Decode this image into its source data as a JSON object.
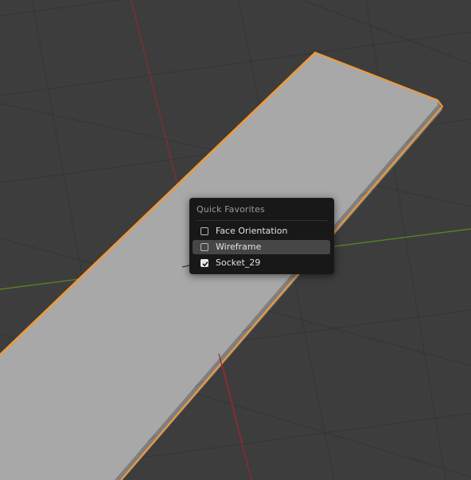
{
  "app": {
    "name": "Blender 3D Viewport"
  },
  "viewport": {
    "background_color": "#3d3d3d",
    "grid_color": "#333333",
    "x_axis_color": "#8a2a33",
    "y_axis_color": "#5c8a1e",
    "selection_outline_color": "#f29a36",
    "object_color": "#a8a8a8"
  },
  "quick_favorites": {
    "title": "Quick Favorites",
    "items": [
      {
        "label": "Face Orientation",
        "checked": false,
        "highlighted": false
      },
      {
        "label": "Wireframe",
        "checked": false,
        "highlighted": true
      },
      {
        "label": "Socket_29",
        "checked": true,
        "highlighted": false
      }
    ]
  }
}
